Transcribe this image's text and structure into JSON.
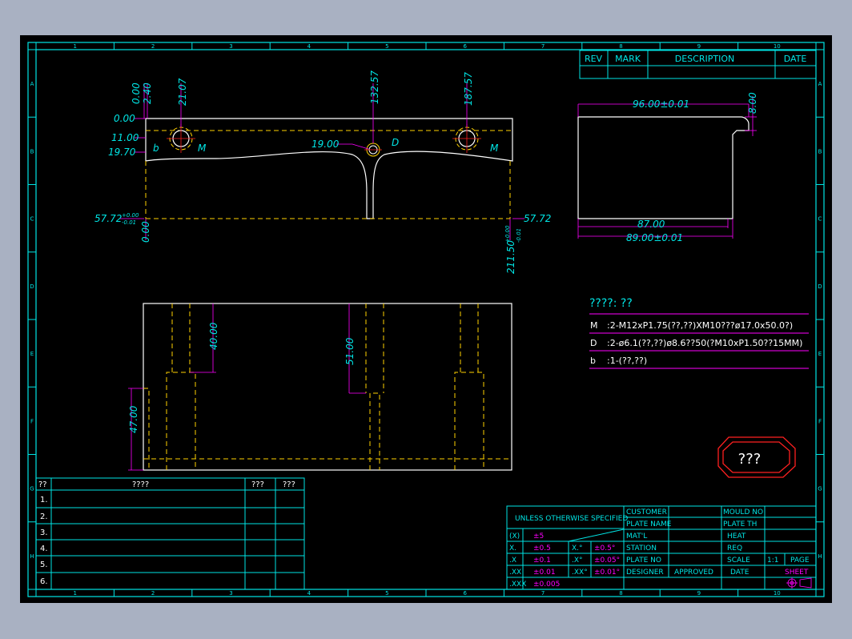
{
  "colors": {
    "background": "#a9b1c2",
    "paper": "#000000",
    "frame": "#00e5e5",
    "object": "#ffffff",
    "hidden": "#ffd200",
    "dimension": "#ff00ff",
    "center": "#ff2020"
  },
  "revision_block": {
    "rev": "REV",
    "mark": "MARK",
    "description": "DESCRIPTION",
    "date": "DATE"
  },
  "grid": {
    "columns": [
      "1",
      "2",
      "3",
      "4",
      "5",
      "6",
      "7",
      "8",
      "9",
      "10"
    ],
    "rows": [
      "A",
      "B",
      "C",
      "D",
      "E",
      "F",
      "G",
      "H"
    ]
  },
  "top_view": {
    "dims": {
      "x0": "0.00",
      "x1": "2.40",
      "x2": "21.07",
      "x3": "132.57",
      "x4": "187.57",
      "y0": "0.00",
      "y1": "11.00",
      "y2": "19.70",
      "y3": "19.00",
      "h_left": "57.72",
      "h_left_tol_up": "+0.00",
      "h_left_tol_dn": "-0.01",
      "h_right": "57.72",
      "bot_left": "0.00",
      "width": "211.50",
      "width_tol_up": "+0.00",
      "width_tol_dn": "-0.01"
    },
    "hole_labels": {
      "m_left": "M",
      "m_right": "M",
      "d": "D",
      "b": "b"
    }
  },
  "side_view": {
    "dims": {
      "top": "96.00±0.01",
      "right": "8.00",
      "bottom_inner": "87.00",
      "bottom_outer": "89.00±0.01"
    }
  },
  "front_view": {
    "dims": {
      "d1": "40.00",
      "d2": "51.00",
      "d3": "47.00"
    }
  },
  "notes": {
    "title": "????: ??",
    "rows": [
      {
        "tag": "M",
        "text": ":2-M12xP1.75(??,??)XM10???ø17.0x50.0?)"
      },
      {
        "tag": "D",
        "text": ":2-ø6.1(??,??)ø8.6??50(?M10xP1.50??15MM)"
      },
      {
        "tag": "b",
        "text": ":1-(??,??)"
      }
    ]
  },
  "stamp": "???",
  "bom": {
    "headers": [
      "??",
      "????",
      "???",
      "???"
    ],
    "rows": [
      "1.",
      "2.",
      "3.",
      "4.",
      "5.",
      "6."
    ]
  },
  "title_block": {
    "unless": "UNLESS OTHERWISE SPECIFIED",
    "tol_rows": [
      {
        "a": "(X)",
        "b": "±5",
        "c": "",
        "d": ""
      },
      {
        "a": "X.",
        "b": "±0.5",
        "c": "X.°",
        "d": "±0.5°"
      },
      {
        "a": ".X",
        "b": "±0.1",
        "c": ".X°",
        "d": "±0.05°"
      },
      {
        "a": ".XX",
        "b": "±0.01",
        "c": ".XX°",
        "d": "±0.01°"
      },
      {
        "a": ".XXX",
        "b": "±0.005",
        "c": "",
        "d": ""
      }
    ],
    "labels": {
      "customer": "CUSTOMER",
      "plate_name": "PLATE NAME",
      "matl": "MAT'L",
      "station": "STATION",
      "plate_no": "PLATE NO",
      "designer": "DESIGNER",
      "approved": "APPROVED",
      "date": "DATE",
      "mould_no": "MOULD NO",
      "plate_th": "PLATE TH",
      "heat": "HEAT",
      "req": "REQ",
      "scale": "SCALE",
      "scale_val": "1:1",
      "page": "PAGE",
      "sheet": "SHEET"
    }
  }
}
